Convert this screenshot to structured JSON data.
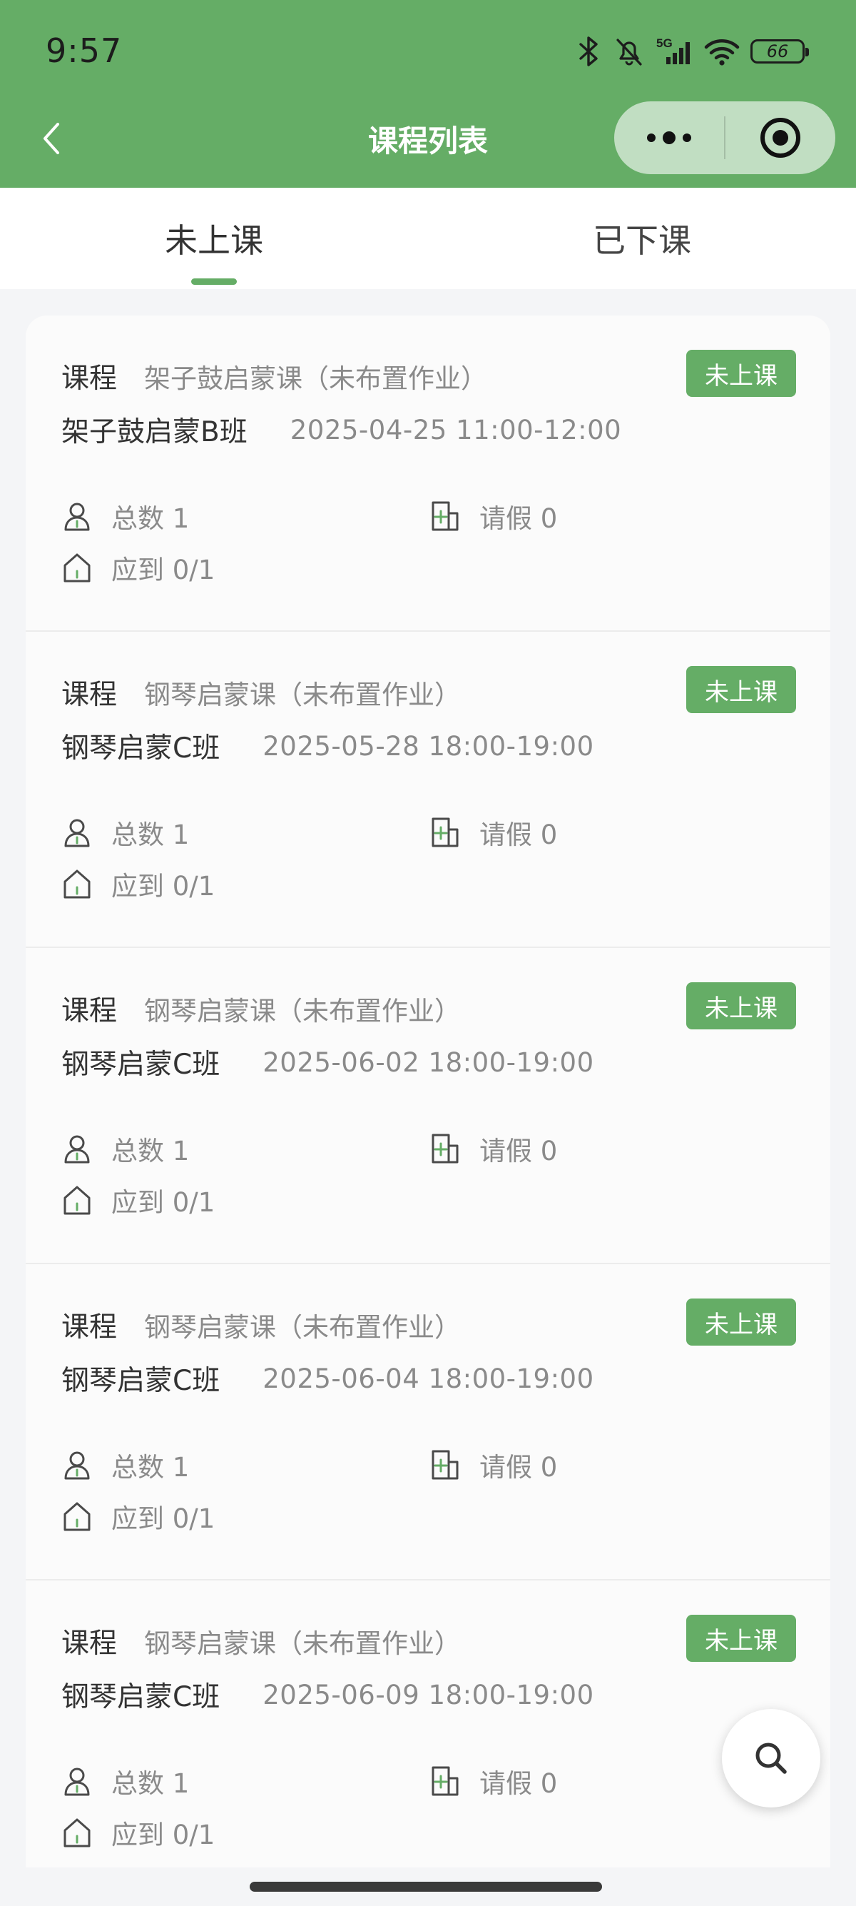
{
  "theme": {
    "brand": "#65ad66",
    "text": "#333333",
    "muted": "#8a8a8a"
  },
  "status_bar": {
    "time": "9:57",
    "network": "5G",
    "battery": "66",
    "icons": [
      "bluetooth-icon",
      "bell-muted-icon",
      "signal-icon",
      "wifi-icon",
      "battery-icon"
    ]
  },
  "nav": {
    "title": "课程列表",
    "back_icon": "chevron-left-icon",
    "menu_icon": "more-dots-icon",
    "close_icon": "target-circle-icon"
  },
  "tabs": [
    {
      "label": "未上课",
      "active": true
    },
    {
      "label": "已下课",
      "active": false
    }
  ],
  "courses": [
    {
      "course_label": "课程",
      "course_name": "架子鼓启蒙课（未布置作业）",
      "class_name": "架子鼓启蒙B班",
      "time": "2025-04-25 11:00-12:00",
      "status": "未上课",
      "total": "总数 1",
      "leave": "请假 0",
      "attend": "应到 0/1"
    },
    {
      "course_label": "课程",
      "course_name": "钢琴启蒙课（未布置作业）",
      "class_name": "钢琴启蒙C班",
      "time": "2025-05-28 18:00-19:00",
      "status": "未上课",
      "total": "总数 1",
      "leave": "请假 0",
      "attend": "应到 0/1"
    },
    {
      "course_label": "课程",
      "course_name": "钢琴启蒙课（未布置作业）",
      "class_name": "钢琴启蒙C班",
      "time": "2025-06-02 18:00-19:00",
      "status": "未上课",
      "total": "总数 1",
      "leave": "请假 0",
      "attend": "应到 0/1"
    },
    {
      "course_label": "课程",
      "course_name": "钢琴启蒙课（未布置作业）",
      "class_name": "钢琴启蒙C班",
      "time": "2025-06-04 18:00-19:00",
      "status": "未上课",
      "total": "总数 1",
      "leave": "请假 0",
      "attend": "应到 0/1"
    },
    {
      "course_label": "课程",
      "course_name": "钢琴启蒙课（未布置作业）",
      "class_name": "钢琴启蒙C班",
      "time": "2025-06-09 18:00-19:00",
      "status": "未上课",
      "total": "总数 1",
      "leave": "请假 0",
      "attend": "应到 0/1"
    }
  ],
  "fab": {
    "icon": "search-icon"
  }
}
